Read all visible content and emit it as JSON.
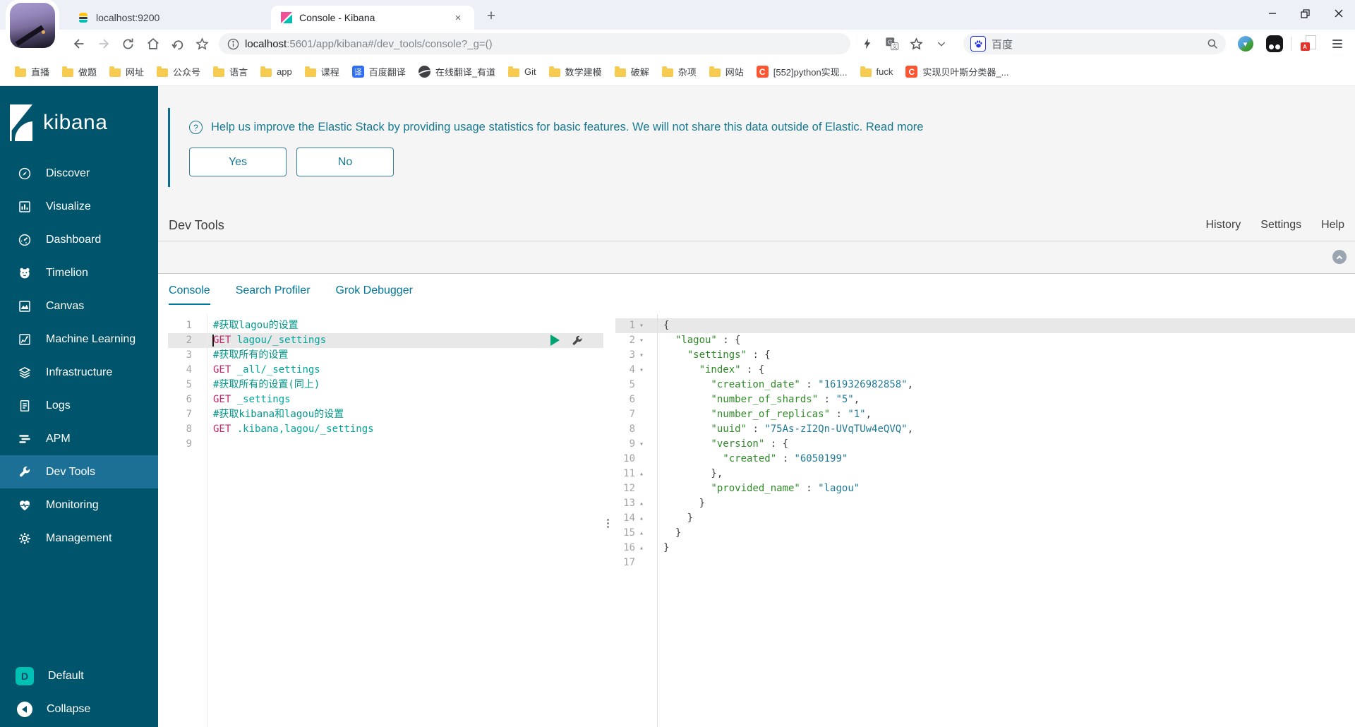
{
  "colors": {
    "sidebar_bg": "#00556d",
    "sidebar_active_bg": "#1d7095",
    "teal_brand": "#00bfb3",
    "kibana_pink": "#f04e98",
    "es_yellow": "#fec514",
    "es_dark": "#343741",
    "link_blue": "#00789b",
    "banner_text": "#16798f",
    "banner_bar": "#0b6e90",
    "method_color": "#c2266b",
    "url_color": "#00a69b",
    "comment_color": "#009688",
    "json_key_color": "#2f8b27",
    "json_value_color": "#1f7a99",
    "active_line_bg": "#e8e8e8",
    "baidu_blue": "#2932e1",
    "csdn_red": "#fc5531"
  },
  "browser": {
    "tabs": [
      {
        "title": "localhost:9200",
        "icon": "elasticsearch",
        "active": false
      },
      {
        "title": "Console - Kibana",
        "icon": "kibana",
        "active": true
      }
    ],
    "url": {
      "host": "localhost",
      "rest": ":5601/app/kibana#/dev_tools/console?_g=()"
    },
    "search_box": {
      "label": "百度"
    },
    "bookmarks": [
      {
        "label": "直播",
        "icon": "folder"
      },
      {
        "label": "做题",
        "icon": "folder"
      },
      {
        "label": "网址",
        "icon": "folder"
      },
      {
        "label": "公众号",
        "icon": "folder"
      },
      {
        "label": "语言",
        "icon": "folder"
      },
      {
        "label": "app",
        "icon": "folder"
      },
      {
        "label": "课程",
        "icon": "folder"
      },
      {
        "label": "百度翻译",
        "icon": "translate"
      },
      {
        "label": "在线翻译_有道",
        "icon": "globe"
      },
      {
        "label": "Git",
        "icon": "folder"
      },
      {
        "label": "数学建模",
        "icon": "folder"
      },
      {
        "label": "破解",
        "icon": "folder"
      },
      {
        "label": "杂项",
        "icon": "folder"
      },
      {
        "label": "网站",
        "icon": "folder"
      },
      {
        "label": "[552]python实现...",
        "icon": "csdn"
      },
      {
        "label": "fuck",
        "icon": "folder"
      },
      {
        "label": "实现贝叶斯分类器_...",
        "icon": "csdn"
      }
    ],
    "translate_icon_char": "译",
    "csdn_icon_char": "C",
    "pdf_icon_char": "A"
  },
  "sidebar": {
    "logo_text": "kibana",
    "items": [
      {
        "label": "Discover",
        "icon": "compass"
      },
      {
        "label": "Visualize",
        "icon": "barchart"
      },
      {
        "label": "Dashboard",
        "icon": "gauge"
      },
      {
        "label": "Timelion",
        "icon": "bear"
      },
      {
        "label": "Canvas",
        "icon": "canvas"
      },
      {
        "label": "Machine Learning",
        "icon": "ml"
      },
      {
        "label": "Infrastructure",
        "icon": "layers"
      },
      {
        "label": "Logs",
        "icon": "document"
      },
      {
        "label": "APM",
        "icon": "bars"
      },
      {
        "label": "Dev Tools",
        "icon": "wrench"
      },
      {
        "label": "Monitoring",
        "icon": "heartbeat"
      },
      {
        "label": "Management",
        "icon": "gear"
      }
    ],
    "active_item": "Dev Tools",
    "bottom_items": [
      {
        "label": "Default",
        "icon": "space-badge",
        "badge": "D"
      },
      {
        "label": "Collapse",
        "icon": "collapse-arrow"
      }
    ]
  },
  "banner": {
    "message": "Help us improve the Elastic Stack by providing usage statistics for basic features. We will not share this data outside of Elastic.",
    "link": "Read more",
    "yes_label": "Yes",
    "no_label": "No"
  },
  "devtools": {
    "title": "Dev Tools",
    "links": [
      "History",
      "Settings",
      "Help"
    ],
    "tabs": [
      "Console",
      "Search Profiler",
      "Grok Debugger"
    ],
    "active_tab": "Console"
  },
  "editor": {
    "active_line": 2,
    "lines": [
      [
        [
          "c",
          "#获取lagou的设置"
        ]
      ],
      [
        [
          "m",
          "GET"
        ],
        [
          "u",
          " lagou/_settings"
        ]
      ],
      [
        [
          "c",
          "#获取所有的设置"
        ]
      ],
      [
        [
          "m",
          "GET"
        ],
        [
          "u",
          " _all/_settings"
        ]
      ],
      [
        [
          "c",
          "#获取所有的设置(同上)"
        ]
      ],
      [
        [
          "m",
          "GET"
        ],
        [
          "u",
          " _settings"
        ]
      ],
      [
        [
          "c",
          "#获取kibana和lagou的设置"
        ]
      ],
      [
        [
          "m",
          "GET"
        ],
        [
          "u",
          " .kibana,lagou/_settings"
        ]
      ],
      []
    ]
  },
  "response": {
    "active_line": 1,
    "lines": [
      [
        [
          "p",
          "{"
        ]
      ],
      [
        [
          "k",
          "  \"lagou\""
        ],
        [
          "p",
          " : {"
        ]
      ],
      [
        [
          "k",
          "    \"settings\""
        ],
        [
          "p",
          " : {"
        ]
      ],
      [
        [
          "k",
          "      \"index\""
        ],
        [
          "p",
          " : {"
        ]
      ],
      [
        [
          "k",
          "        \"creation_date\""
        ],
        [
          "p",
          " : "
        ],
        [
          "v",
          "\"1619326982858\""
        ],
        [
          "p",
          ","
        ]
      ],
      [
        [
          "k",
          "        \"number_of_shards\""
        ],
        [
          "p",
          " : "
        ],
        [
          "v",
          "\"5\""
        ],
        [
          "p",
          ","
        ]
      ],
      [
        [
          "k",
          "        \"number_of_replicas\""
        ],
        [
          "p",
          " : "
        ],
        [
          "v",
          "\"1\""
        ],
        [
          "p",
          ","
        ]
      ],
      [
        [
          "k",
          "        \"uuid\""
        ],
        [
          "p",
          " : "
        ],
        [
          "v",
          "\"75As-zI2Qn-UVqTUw4eQVQ\""
        ],
        [
          "p",
          ","
        ]
      ],
      [
        [
          "k",
          "        \"version\""
        ],
        [
          "p",
          " : {"
        ]
      ],
      [
        [
          "k",
          "          \"created\""
        ],
        [
          "p",
          " : "
        ],
        [
          "v",
          "\"6050199\""
        ]
      ],
      [
        [
          "p",
          "        },"
        ]
      ],
      [
        [
          "k",
          "        \"provided_name\""
        ],
        [
          "p",
          " : "
        ],
        [
          "v",
          "\"lagou\""
        ]
      ],
      [
        [
          "p",
          "      }"
        ]
      ],
      [
        [
          "p",
          "    }"
        ]
      ],
      [
        [
          "p",
          "  }"
        ]
      ],
      [
        [
          "p",
          "}"
        ]
      ],
      []
    ],
    "folds": {
      "1": "down",
      "2": "down",
      "3": "down",
      "4": "down",
      "9": "down",
      "11": "up",
      "13": "up",
      "14": "up",
      "15": "up",
      "16": "up"
    }
  }
}
